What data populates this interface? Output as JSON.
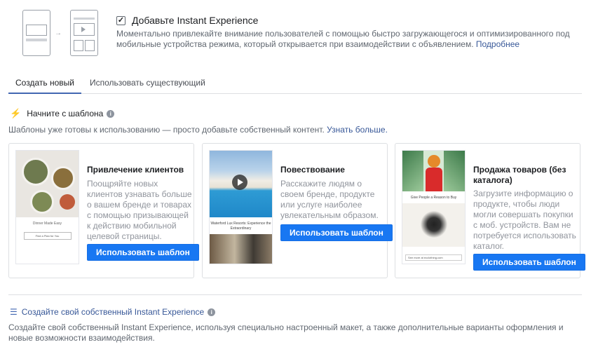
{
  "header": {
    "checkbox_checked": true,
    "title": "Добавьте Instant Experience",
    "description": "Моментально привлекайте внимание пользователей с помощью быстро загружающегося и оптимизированного под мобильные устройства режима, который открывается при взаимодействии с объявлением.",
    "learn_more": "Подробнее"
  },
  "tabs": [
    {
      "label": "Создать новый",
      "active": true
    },
    {
      "label": "Использовать существующий",
      "active": false
    }
  ],
  "templates": {
    "heading": "Начните с шаблона",
    "description": "Шаблоны уже готовы к использованию — просто добавьте собственный контент.",
    "learn_more": "Узнать больше."
  },
  "cards": [
    {
      "title": "Привлечение клиентов",
      "description": "Поощряйте новых клиентов узнавать больше о вашем бренде и товарах с помощью призывающей к действию мобильной целевой страницы.",
      "button": "Использовать шаблон",
      "thumb": {
        "headline": "Dinner Made Easy",
        "button": "Find a Plan for You"
      }
    },
    {
      "title": "Повествование",
      "description": "Расскажите людям о своем бренде, продукте или услуге наиболее увлекательным образом.",
      "button": "Использовать шаблон",
      "thumb": {
        "headline": "Waterford Lux Resorts: Experience the Extraordinary"
      }
    },
    {
      "title": "Продажа товаров (без каталога)",
      "description": "Загрузите информацию о продукте, чтобы люди могли совершать покупки с моб. устройств. Вам не потребуется использовать каталог.",
      "button": "Использовать шаблон",
      "thumb": {
        "headline": "Give People a Reason to Buy",
        "footer": "See more at ecclothing.com"
      }
    }
  ],
  "custom": {
    "title": "Создайте свой собственный Instant Experience",
    "description": "Создайте свой собственный Instant Experience, используя специально настроенный макет, а также дополнительные варианты оформления и новые возможности взаимодействия."
  },
  "colors": {
    "link": "#385898",
    "button": "#1877f2",
    "tab_active": "#4267b2"
  }
}
